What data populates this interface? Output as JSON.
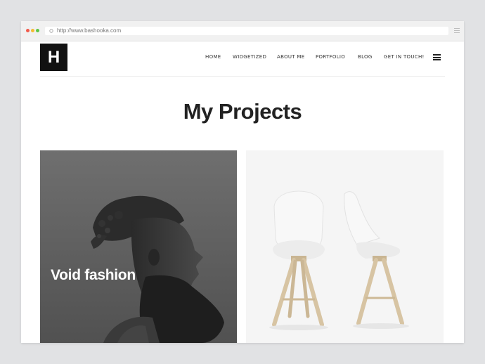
{
  "browser": {
    "url": "http://www.bashooka.com"
  },
  "header": {
    "logo_letter": "H",
    "nav": [
      "HOME",
      "WIDGETIZED",
      "ABOUT ME",
      "PORTFOLIO",
      "BLOG",
      "GET IN TOUCH!"
    ]
  },
  "main": {
    "title": "My Projects",
    "projects": [
      {
        "title": "Void fashion",
        "image": "bearded-man-portrait"
      },
      {
        "title": "",
        "image": "white-chairs"
      }
    ]
  },
  "colors": {
    "background": "#e1e2e4",
    "text": "#222222",
    "logo_bg": "#111111"
  }
}
